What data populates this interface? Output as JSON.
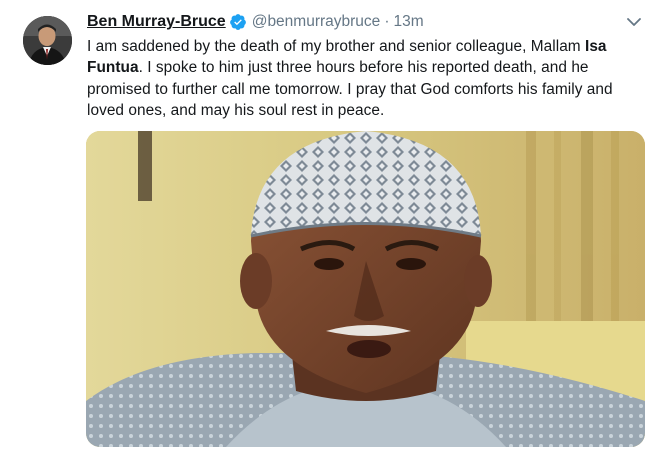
{
  "tweet": {
    "author_name": "Ben Murray-Bruce",
    "handle": "@benmurraybruce",
    "separator": "·",
    "time": "13m",
    "text_part1": "I am saddened by the death of my brother and senior colleague, Mallam ",
    "text_bold1": "Isa",
    "text_bold2": "Funtua",
    "text_part2": ". I spoke to him just three hours before his reported death, and he promised to further call me tomorrow. I pray that God comforts his family and loved ones, and may his soul rest in peace.",
    "icons": {
      "verified": "verified-badge-icon",
      "more": "chevron-down-icon"
    },
    "colors": {
      "verified": "#1da1f2",
      "text": "#14171a",
      "muted": "#657786"
    }
  }
}
